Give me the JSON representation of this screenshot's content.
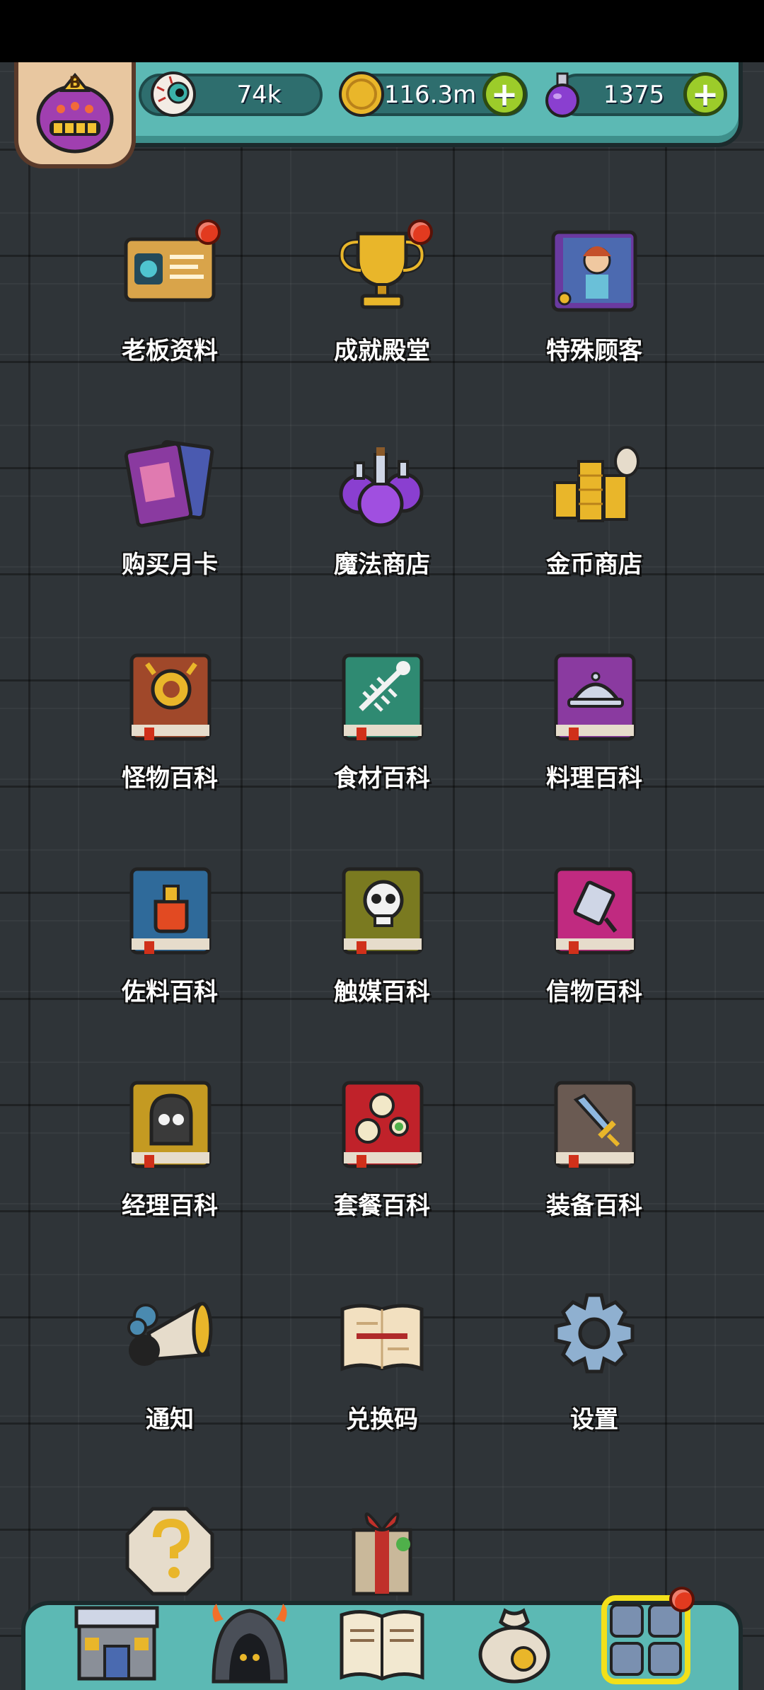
{
  "status_bar": {},
  "top_bar": {
    "eyeball": {
      "value": "74k",
      "icon": "eyeball-icon"
    },
    "gold": {
      "value": "116.3m",
      "icon": "gold-coin-icon"
    },
    "potion": {
      "value": "1375",
      "icon": "purple-potion-icon"
    },
    "plus_label": "+"
  },
  "avatar": {
    "badge": "B"
  },
  "menu": {
    "items": [
      {
        "label": "老板资料",
        "icon": "boss-card-icon",
        "badge": true
      },
      {
        "label": "成就殿堂",
        "icon": "trophy-icon",
        "badge": true
      },
      {
        "label": "特殊顾客",
        "icon": "special-customer-book-icon",
        "badge": false
      },
      {
        "label": "购买月卡",
        "icon": "monthly-card-icon",
        "badge": false
      },
      {
        "label": "魔法商店",
        "icon": "magic-potions-icon",
        "badge": false
      },
      {
        "label": "金币商店",
        "icon": "coin-stack-icon",
        "badge": false
      },
      {
        "label": "怪物百科",
        "icon": "monster-book-icon",
        "badge": false
      },
      {
        "label": "食材百科",
        "icon": "ingredient-book-icon",
        "badge": false
      },
      {
        "label": "料理百科",
        "icon": "cuisine-book-icon",
        "badge": false
      },
      {
        "label": "佐料百科",
        "icon": "seasoning-book-icon",
        "badge": false
      },
      {
        "label": "触媒百科",
        "icon": "catalyst-book-icon",
        "badge": false
      },
      {
        "label": "信物百科",
        "icon": "token-book-icon",
        "badge": false
      },
      {
        "label": "经理百科",
        "icon": "manager-book-icon",
        "badge": false
      },
      {
        "label": "套餐百科",
        "icon": "set-meal-book-icon",
        "badge": false
      },
      {
        "label": "装备百科",
        "icon": "equipment-book-icon",
        "badge": false
      },
      {
        "label": "通知",
        "icon": "megaphone-icon",
        "badge": false
      },
      {
        "label": "兑换码",
        "icon": "scroll-icon",
        "badge": false
      },
      {
        "label": "设置",
        "icon": "gear-icon",
        "badge": false
      }
    ],
    "partial_row": [
      {
        "icon": "help-question-icon"
      },
      {
        "icon": "gift-icon"
      }
    ]
  },
  "bottom_nav": [
    {
      "icon": "restaurant-icon"
    },
    {
      "icon": "monster-cave-icon"
    },
    {
      "icon": "open-book-icon"
    },
    {
      "icon": "money-bag-icon"
    },
    {
      "icon": "menu-grid-icon",
      "badge": true,
      "active": true
    }
  ],
  "colors": {
    "background": "#2f3438",
    "bar_teal": "#5cb9b4",
    "plus_green": "#9ccc2a",
    "badge_red": "#e23a1f",
    "gold": "#e9b62a"
  }
}
